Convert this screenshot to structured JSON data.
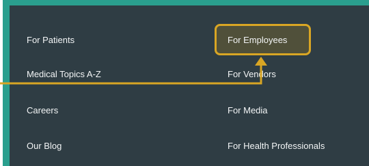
{
  "menu": {
    "left_column": [
      {
        "label": "For Patients"
      },
      {
        "label": "Medical Topics A-Z"
      },
      {
        "label": "Careers"
      },
      {
        "label": "Our Blog"
      }
    ],
    "right_column": [
      {
        "label": "For Employees"
      },
      {
        "label": "For Vendors"
      },
      {
        "label": "For Media"
      },
      {
        "label": "For Health Professionals"
      }
    ]
  },
  "colors": {
    "panel_background": "#2f3d44",
    "frame_accent": "#2a9f8e",
    "highlight": "#d9a624",
    "link_text": "#f3f5f6"
  }
}
